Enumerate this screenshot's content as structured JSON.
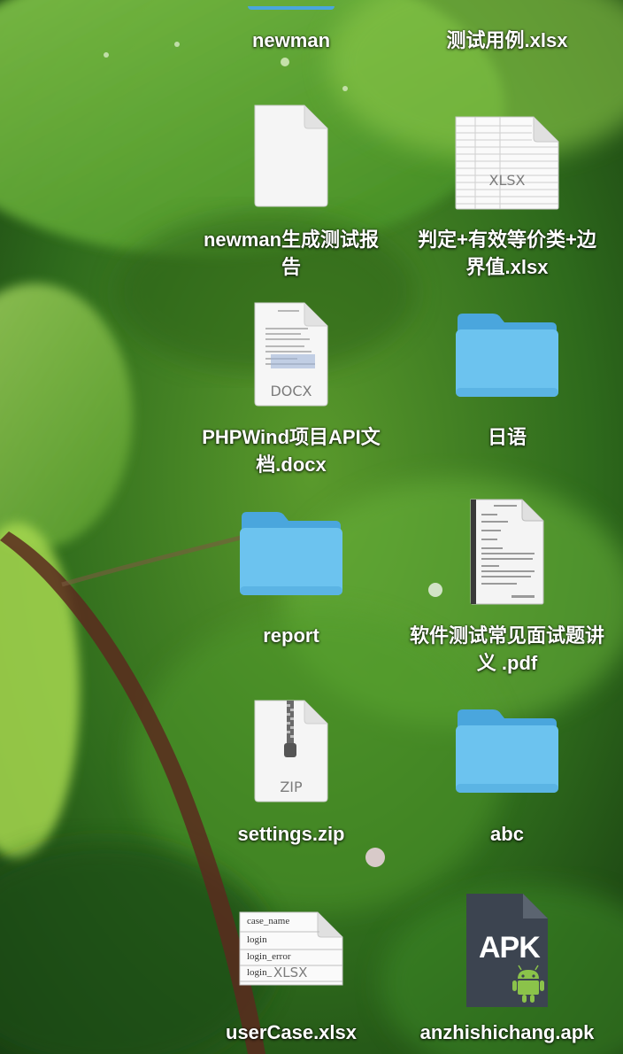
{
  "desktop": {
    "items": [
      {
        "label": "newman",
        "icon": "blue-item-icon"
      },
      {
        "label": "测试用例.xlsx",
        "icon": "xlsx-file-icon"
      },
      {
        "label": "newman生成测试报告",
        "icon": "document-file-icon"
      },
      {
        "label": "判定+有效等价类+边界值.xlsx",
        "icon": "xlsx-file-icon",
        "badge": "XLSX"
      },
      {
        "label": "PHPWind项目API文档.docx",
        "icon": "docx-file-icon",
        "badge": "DOCX"
      },
      {
        "label": "日语",
        "icon": "folder-icon"
      },
      {
        "label": "report",
        "icon": "folder-icon"
      },
      {
        "label": "软件测试常见面试题讲义 .pdf",
        "icon": "pdf-file-icon"
      },
      {
        "label": "settings.zip",
        "icon": "zip-file-icon",
        "badge": "ZIP"
      },
      {
        "label": "abc",
        "icon": "folder-icon"
      },
      {
        "label": "userCase.xlsx",
        "icon": "xlsx-file-icon",
        "badge": "XLSX",
        "rows": [
          "case_name",
          "login",
          "login_error",
          "login_"
        ]
      },
      {
        "label": "anzhishichang.apk",
        "icon": "apk-file-icon",
        "badge": "APK"
      }
    ]
  },
  "colors": {
    "folder_body": "#6cc3ef",
    "folder_tab": "#4aa6dd",
    "label_text": "#ffffff"
  }
}
